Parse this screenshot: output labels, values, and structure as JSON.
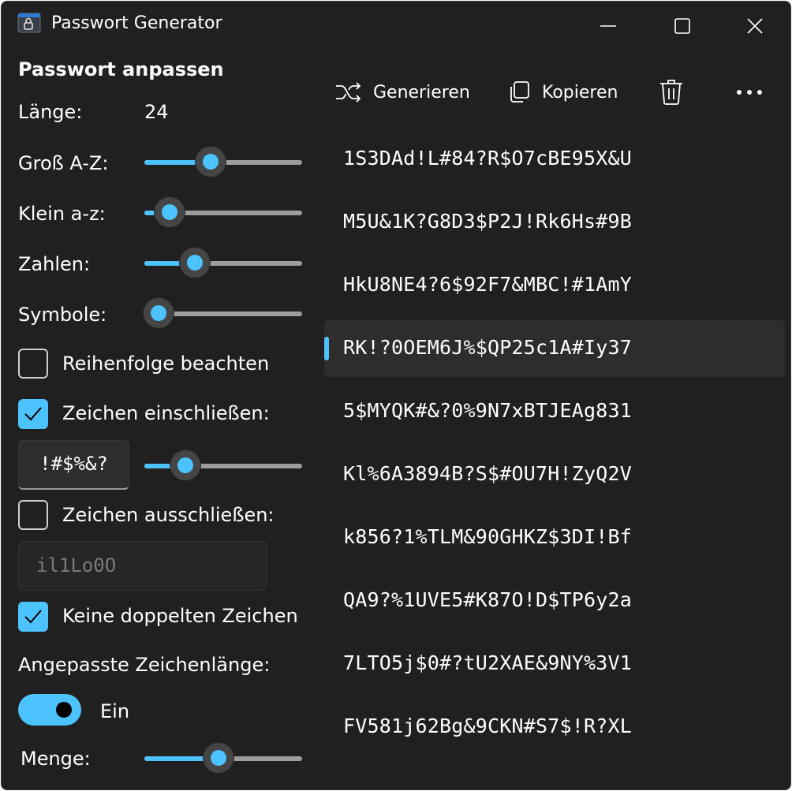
{
  "window": {
    "title": "Passwort Generator"
  },
  "settings": {
    "section_title": "Passwort anpassen",
    "length_label": "Länge:",
    "length_value": "24",
    "upper_label": "Groß A-Z:",
    "upper_level": 0.42,
    "lower_label": "Klein a-z:",
    "lower_level": 0.16,
    "numbers_label": "Zahlen:",
    "numbers_level": 0.32,
    "symbols_label": "Symbole:",
    "symbols_level": 0.09,
    "order_label": "Reihenfolge beachten",
    "order_checked": false,
    "include_label": "Zeichen einschließen:",
    "include_checked": true,
    "include_chars": "!#$%&?",
    "include_level": 0.26,
    "exclude_label": "Zeichen ausschließen:",
    "exclude_checked": false,
    "exclude_placeholder": "il1Lo0O",
    "no_duplicates_label": "Keine doppelten Zeichen",
    "no_duplicates_checked": true,
    "custom_length_label": "Angepasste Zeichenlänge:",
    "toggle_state": "Ein",
    "amount_label": "Menge:",
    "amount_level": 0.47
  },
  "toolbar": {
    "generate_label": "Generieren",
    "copy_label": "Kopieren"
  },
  "passwords": [
    "1S3DAd!L#84?R$O7cBE95X&U",
    "M5U&1K?G8D3$P2J!Rk6Hs#9B",
    "HkU8NE4?6$92F7&MBC!#1AmY",
    "RK!?0OEM6J%$QP25c1A#Iy37",
    "5$MYQK#&?0%9N7xBTJEAg831",
    "Kl%6A3894B?S$#OU7H!ZyQ2V",
    "k856?1%TLM&90GHKZ$3DI!Bf",
    "QA9?%1UVE5#K87O!D$TP6y2a",
    "7LTO5j$0#?tU2XAE&9NY%3V1",
    "FV581j62Bg&9CKN#S7$!R?XL"
  ],
  "selected_index": 3,
  "colors": {
    "accent": "#4cc2ff",
    "background": "#202020",
    "selected_row": "#2d2d2d"
  }
}
